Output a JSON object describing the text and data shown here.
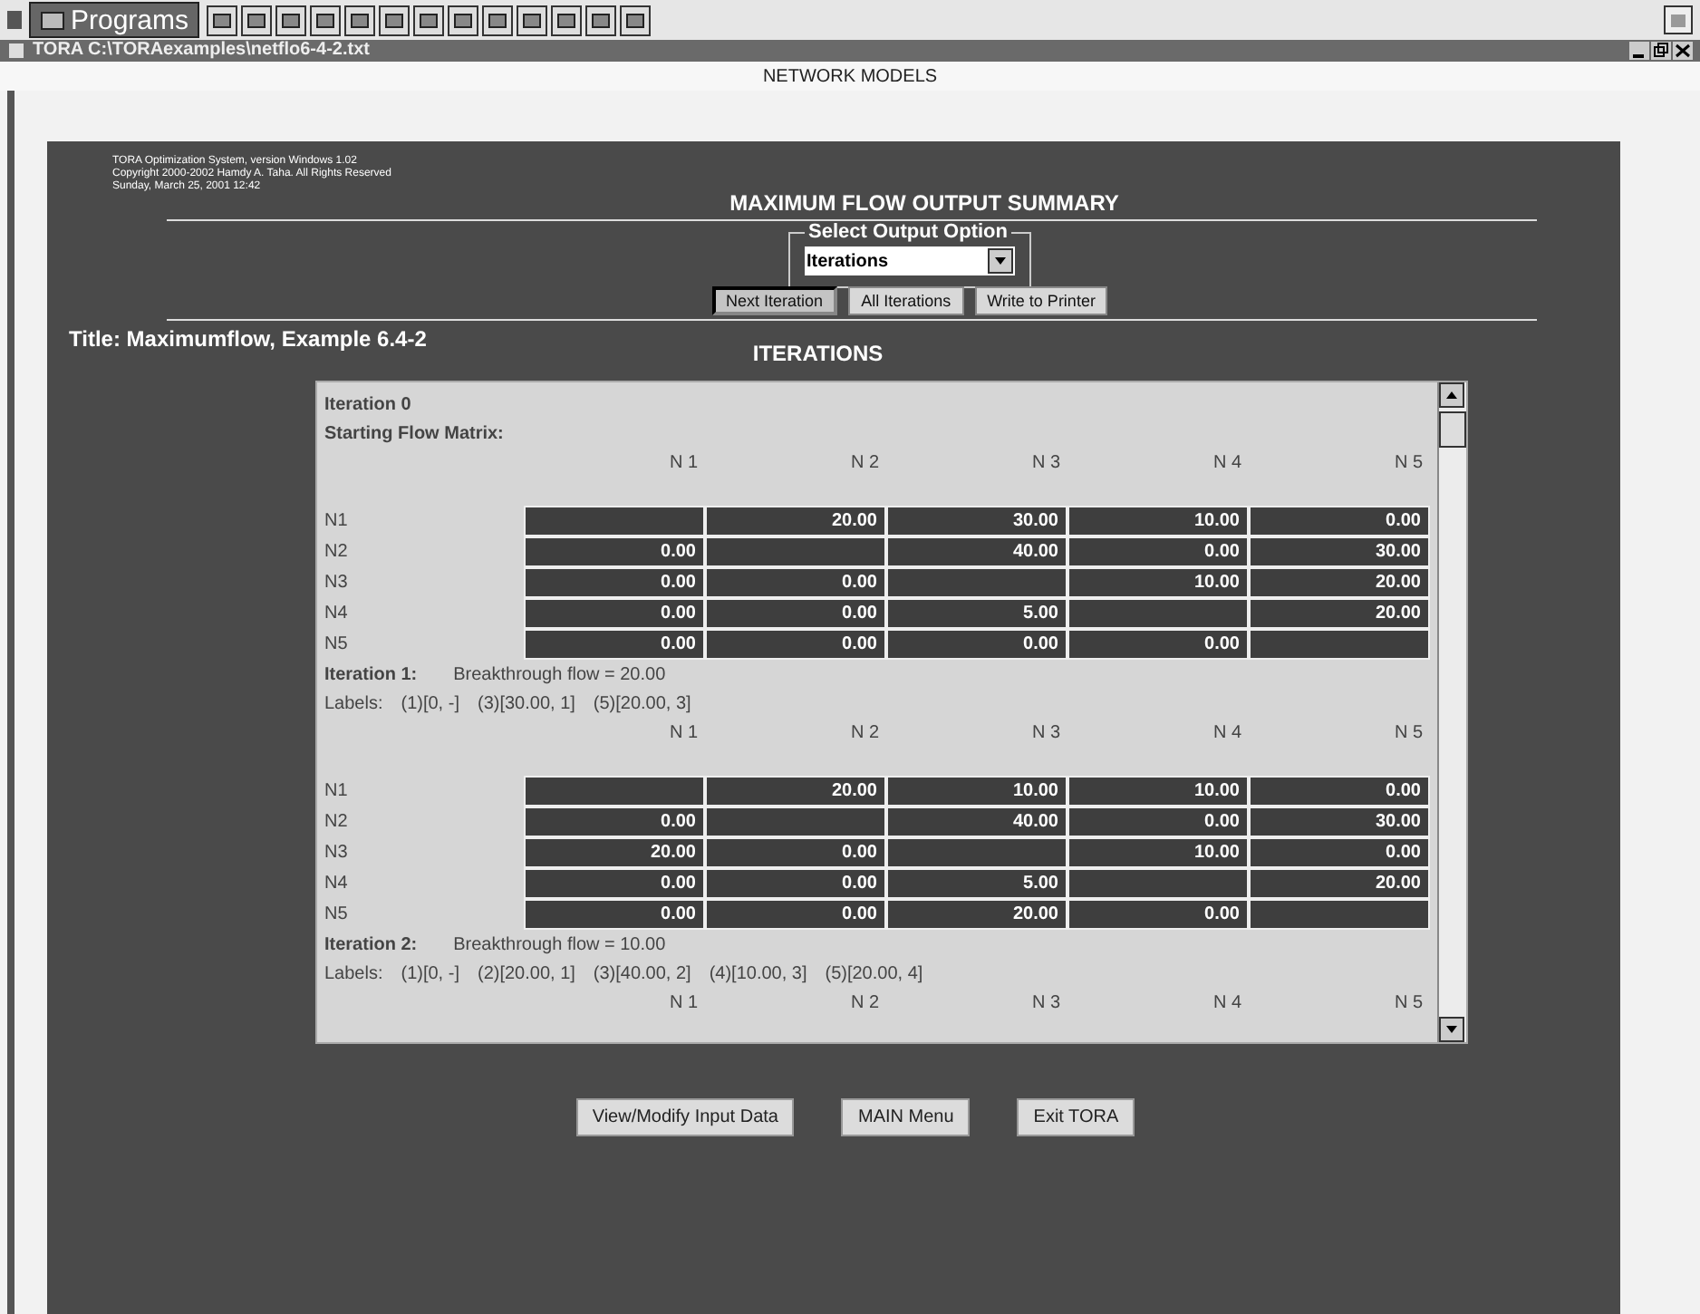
{
  "taskbar": {
    "menu_label": "Programs"
  },
  "window": {
    "title": "TORA C:\\TORAexamples\\netflo6-4-2.txt",
    "header": "NETWORK MODELS"
  },
  "info_lines": [
    "TORA Optimization System, version Windows 1.02",
    "Copyright 2000-2002 Hamdy A. Taha. All Rights Reserved",
    "Sunday, March 25, 2001 12:42"
  ],
  "summary_title": "MAXIMUM FLOW OUTPUT SUMMARY",
  "output_option": {
    "legend": "Select Output Option",
    "value": "Iterations"
  },
  "actions": [
    {
      "label": "Next Iteration",
      "selected": true
    },
    {
      "label": "All Iterations",
      "selected": false
    },
    {
      "label": "Write to Printer",
      "selected": false
    }
  ],
  "problem_title": "Title: Maximumflow, Example 6.4-2",
  "section_title": "ITERATIONS",
  "iterations": [
    {
      "heading": "Iteration 0",
      "subheading": "Starting Flow Matrix:",
      "columns": [
        "N 1",
        "N 2",
        "N 3",
        "N 4",
        "N 5"
      ],
      "rows": [
        {
          "label": "N1",
          "cells": [
            null,
            "20.00",
            "30.00",
            "10.00",
            "0.00"
          ]
        },
        {
          "label": "N2",
          "cells": [
            "0.00",
            null,
            "40.00",
            "0.00",
            "30.00"
          ]
        },
        {
          "label": "N3",
          "cells": [
            "0.00",
            "0.00",
            null,
            "10.00",
            "20.00"
          ]
        },
        {
          "label": "N4",
          "cells": [
            "0.00",
            "0.00",
            "5.00",
            null,
            "20.00"
          ]
        },
        {
          "label": "N5",
          "cells": [
            "0.00",
            "0.00",
            "0.00",
            "0.00",
            null
          ]
        }
      ]
    },
    {
      "heading": "Iteration 1:",
      "flow": "Breakthrough flow = 20.00",
      "labels_title": "Labels:",
      "labels": [
        "(1)[0, -]",
        "(3)[30.00, 1]",
        "(5)[20.00, 3]"
      ],
      "columns": [
        "N 1",
        "N 2",
        "N 3",
        "N 4",
        "N 5"
      ],
      "rows": [
        {
          "label": "N1",
          "cells": [
            null,
            "20.00",
            "10.00",
            "10.00",
            "0.00"
          ]
        },
        {
          "label": "N2",
          "cells": [
            "0.00",
            null,
            "40.00",
            "0.00",
            "30.00"
          ]
        },
        {
          "label": "N3",
          "cells": [
            "20.00",
            "0.00",
            null,
            "10.00",
            "0.00"
          ]
        },
        {
          "label": "N4",
          "cells": [
            "0.00",
            "0.00",
            "5.00",
            null,
            "20.00"
          ]
        },
        {
          "label": "N5",
          "cells": [
            "0.00",
            "0.00",
            "20.00",
            "0.00",
            null
          ]
        }
      ]
    },
    {
      "heading": "Iteration 2:",
      "flow": "Breakthrough flow = 10.00",
      "labels_title": "Labels:",
      "labels": [
        "(1)[0, -]",
        "(2)[20.00, 1]",
        "(3)[40.00, 2]",
        "(4)[10.00, 3]",
        "(5)[20.00, 4]"
      ],
      "columns": [
        "N 1",
        "N 2",
        "N 3",
        "N 4",
        "N 5"
      ]
    }
  ],
  "bottom_buttons": [
    "View/Modify Input Data",
    "MAIN Menu",
    "Exit TORA"
  ]
}
